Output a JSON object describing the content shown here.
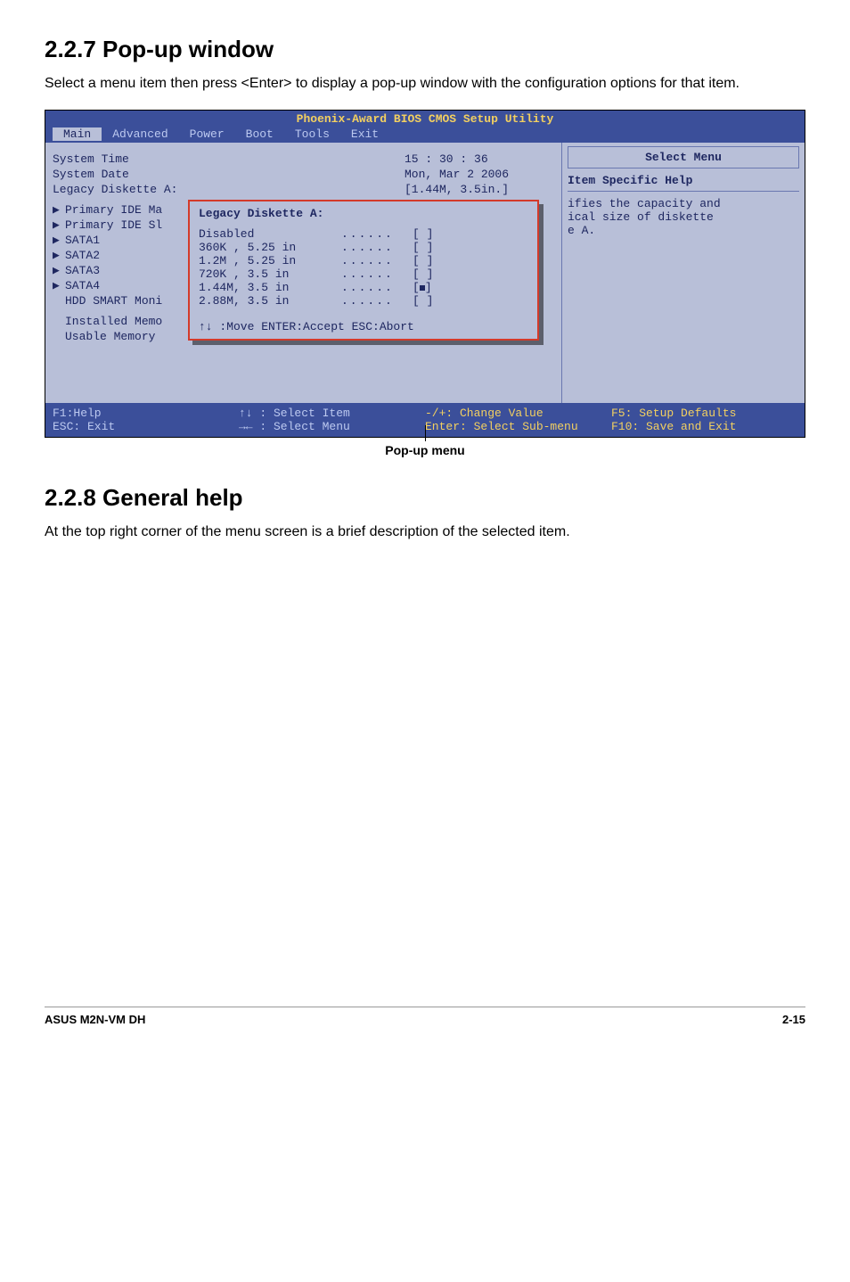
{
  "section227": {
    "heading": "2.2.7  Pop-up window",
    "body": "Select a menu item then press <Enter> to display a pop-up window with the configuration options for that item."
  },
  "bios": {
    "title": "Phoenix-Award BIOS CMOS Setup Utility",
    "tabs": [
      "Main",
      "Advanced",
      "Power",
      "Boot",
      "Tools",
      "Exit"
    ],
    "items": {
      "system_time_label": "System Time",
      "system_time_value": "15 : 30 : 36",
      "system_date_label": "System Date",
      "system_date_value": "Mon, Mar 2 2006",
      "legacy_label": "Legacy Diskette A:",
      "legacy_value": "[1.44M, 3.5in.]",
      "submenus": [
        "Primary IDE Ma",
        "Primary IDE Sl",
        "SATA1",
        "SATA2",
        "SATA3",
        "SATA4",
        "HDD SMART Moni"
      ],
      "installed_mem": "Installed Memo",
      "usable_mem": "Usable Memory"
    },
    "right": {
      "select_menu": "Select Menu",
      "help_header": "Item Specific Help",
      "help_body_line1": "ifies the capacity and",
      "help_body_line2": "ical size of diskette",
      "help_body_line3": "e A."
    },
    "popup": {
      "title": "Legacy Diskette A:",
      "options": [
        {
          "label": "Disabled",
          "selected": false
        },
        {
          "label": "360K , 5.25 in",
          "selected": false
        },
        {
          "label": "1.2M , 5.25 in",
          "selected": false
        },
        {
          "label": "720K , 3.5 in",
          "selected": false
        },
        {
          "label": "1.44M, 3.5 in",
          "selected": true
        },
        {
          "label": "2.88M, 3.5 in",
          "selected": false
        }
      ],
      "nav": "↑↓ :Move   ENTER:Accept   ESC:Abort"
    },
    "footer": {
      "f1": "F1:Help",
      "select_item": "↑↓ : Select Item",
      "change_value": "-/+:  Change Value",
      "setup_defaults": "F5: Setup Defaults",
      "esc": "ESC: Exit",
      "select_menu_nav": "→← : Select Menu",
      "enter_sub": "Enter: Select Sub-menu",
      "save_exit": "F10: Save and Exit"
    }
  },
  "caption": "Pop-up menu",
  "section228": {
    "heading": "2.2.8  General help",
    "body": "At the top right corner of the menu screen is a brief description of the selected item."
  },
  "page_footer": {
    "left": "ASUS M2N-VM DH",
    "right": "2-15"
  }
}
